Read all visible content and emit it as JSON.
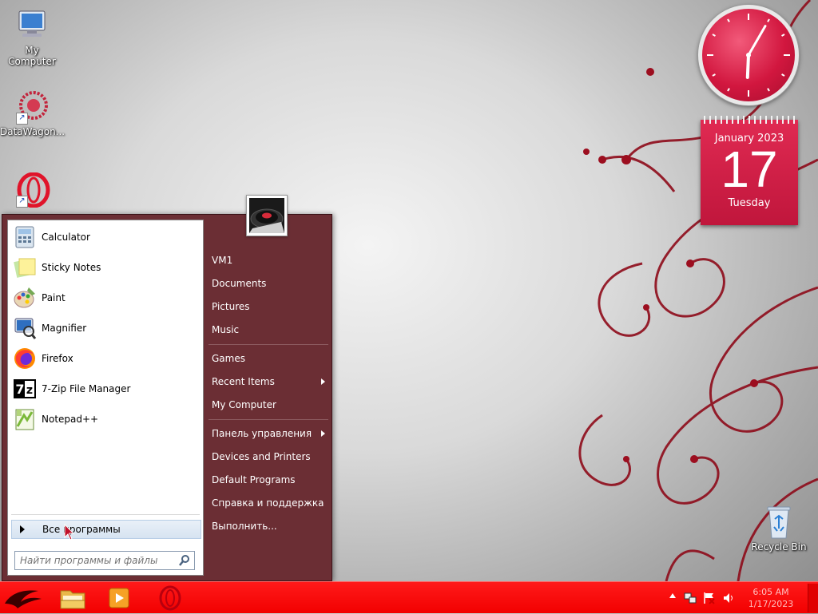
{
  "desktop": {
    "icons": [
      {
        "label": "My Computer",
        "icon": "monitor-icon"
      },
      {
        "label": "DataWagon...",
        "icon": "datawagon-icon"
      },
      {
        "label": "",
        "icon": "opera-icon"
      },
      {
        "label": "Recycle Bin",
        "icon": "recycle-bin-icon"
      }
    ]
  },
  "gadgets": {
    "clock": {
      "hour": 6,
      "minute": 5
    },
    "calendar": {
      "month_year": "January 2023",
      "day": "17",
      "weekday": "Tuesday"
    }
  },
  "start_menu": {
    "programs": [
      {
        "label": "Calculator",
        "icon": "calculator-icon"
      },
      {
        "label": "Sticky Notes",
        "icon": "sticky-notes-icon"
      },
      {
        "label": "Paint",
        "icon": "paint-icon"
      },
      {
        "label": "Magnifier",
        "icon": "magnifier-icon"
      },
      {
        "label": "Firefox",
        "icon": "firefox-icon"
      },
      {
        "label": "7-Zip File Manager",
        "icon": "7zip-icon"
      },
      {
        "label": "Notepad++",
        "icon": "notepadpp-icon"
      }
    ],
    "all_programs": "Все программы",
    "search_placeholder": "Найти программы и файлы",
    "right_items": [
      {
        "label": "VM1",
        "submenu": false
      },
      {
        "label": "Documents",
        "submenu": false
      },
      {
        "label": "Pictures",
        "submenu": false
      },
      {
        "label": "Music",
        "submenu": false
      },
      {
        "label": "Games",
        "submenu": false
      },
      {
        "label": "Recent Items",
        "submenu": true
      },
      {
        "label": "My Computer",
        "submenu": false
      },
      {
        "label": "Панель управления",
        "submenu": true
      },
      {
        "label": "Devices and Printers",
        "submenu": false
      },
      {
        "label": "Default Programs",
        "submenu": false
      },
      {
        "label": "Справка и поддержка",
        "submenu": false
      },
      {
        "label": "Выполнить...",
        "submenu": false
      }
    ]
  },
  "taskbar": {
    "pinned": [
      "file-explorer-icon",
      "media-player-icon",
      "opera-icon"
    ],
    "time": "6:05 AM",
    "date": "1/17/2023",
    "tray_icons": [
      "show-hidden-icons-chevron",
      "network-icon",
      "action-center-flag-icon",
      "volume-icon"
    ]
  },
  "colors": {
    "taskbar": "#f20000",
    "start_menu_right": "#6b2e34",
    "accent": "#d2173f"
  }
}
